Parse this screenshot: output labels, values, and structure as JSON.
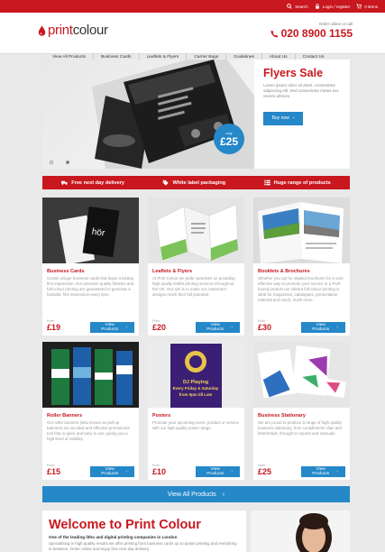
{
  "topbar": {
    "search": "Search",
    "login": "Login / register",
    "cart": "0 items"
  },
  "header": {
    "logo_part1": "print",
    "logo_part2": "colour",
    "order_text": "Order online or call",
    "phone": "020 8900 1155"
  },
  "nav": [
    "View All Products",
    "Business Cards",
    "Leaflets & Flyers",
    "Carrier Bags",
    "Guidelines",
    "About Us",
    "Contact Us"
  ],
  "hero": {
    "title": "Flyers Sale",
    "text": "Lorem ipsum dolor sit amet, consectetur adipiscing elit. Sed consectetur metus nec viverra ultrices.",
    "button": "Buy now",
    "badge_label": "only",
    "badge_price": "£25",
    "slides": 2,
    "active_slide": 1
  },
  "features": [
    {
      "icon": "truck-icon",
      "label": "Free next day delivery"
    },
    {
      "icon": "tag-icon",
      "label": "White label packaging"
    },
    {
      "icon": "list-icon",
      "label": "Huge range of products"
    }
  ],
  "products": [
    {
      "title": "Business Cards",
      "desc": "Create unique business cards that leave a lasting first impression. Our premium quality finishes and full-colour printing are guaranteed to generate a fantastic first impression every time.",
      "from": "From",
      "price": "£19",
      "button": "View Products"
    },
    {
      "title": "Leaflets & Flyers",
      "desc": "At Print Colour we pride ourselves on providing high quality leaflet printing services throughout the UK. Our aim is to make our customers' designs reach their full potential.",
      "from": "From",
      "price": "£20",
      "button": "View Products"
    },
    {
      "title": "Booklets & Brochures",
      "desc": "Whether you opt for stapled brochures for a cost-effective way to promote your service or a PUR bound product our vibrant full-colour printing is ideal for magazines, catalogues, presentation material and much, much more.",
      "from": "From",
      "price": "£30",
      "button": "View Products"
    },
    {
      "title": "Roller Banners",
      "desc": "Our roller banners (also known as pull-up banners) are an ideal and effective promotional tool that is quick and easy to use, giving you a high level of visibility.",
      "from": "From",
      "price": "£15",
      "button": "View Products"
    },
    {
      "title": "Posters",
      "desc": "Promote your upcoming event, product or service with our high quality poster range.",
      "from": "From",
      "price": "£10",
      "button": "View Products"
    },
    {
      "title": "Business Stationary",
      "desc": "We are proud to produce a range of high quality business stationary, from compliments slips and letterheads, through to reports and manuals.",
      "from": "From",
      "price": "£25",
      "button": "View Products"
    }
  ],
  "poster_text": {
    "line1": "DJ Playing",
    "line2": "Every Friday & Saturday",
    "line3": "from 9pm till Late"
  },
  "view_all": "View All Products",
  "welcome": {
    "title": "Welcome to Print Colour",
    "subtitle": "One of the leading litho and digital printing companies in London",
    "text": "Specialising in high quality results we offer printing from business cards up to poster printing and everything in between. Order online and enjoy free next day delivery."
  },
  "colors": {
    "brand_red": "#c8171e",
    "accent_blue": "#2488c9"
  }
}
